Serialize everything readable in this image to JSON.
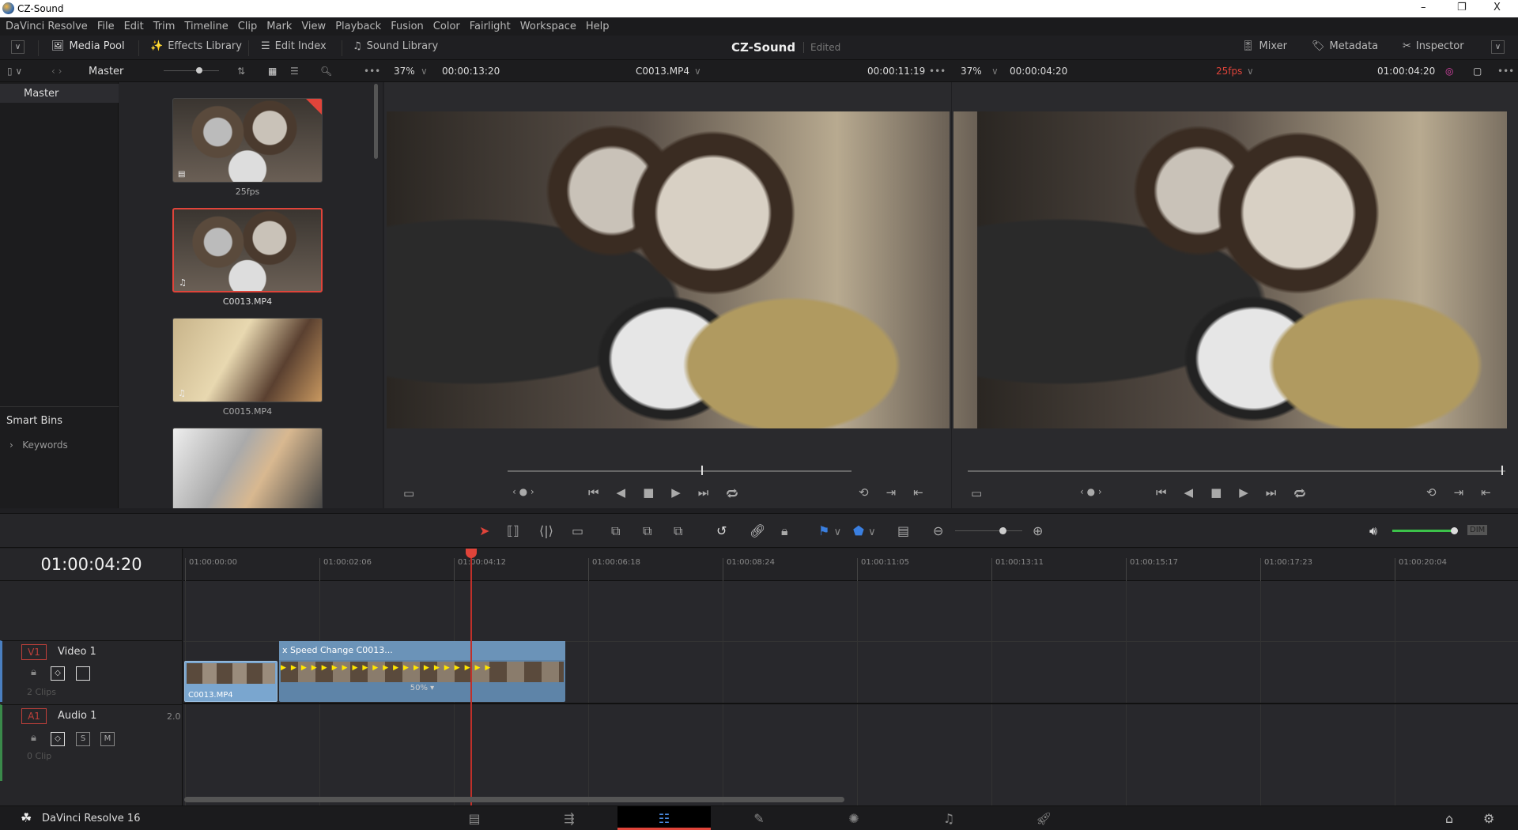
{
  "window": {
    "title": "CZ-Sound",
    "minimize": "–",
    "restore": "❐",
    "close": "X"
  },
  "menu": [
    "DaVinci Resolve",
    "File",
    "Edit",
    "Trim",
    "Timeline",
    "Clip",
    "Mark",
    "View",
    "Playback",
    "Fusion",
    "Color",
    "Fairlight",
    "Workspace",
    "Help"
  ],
  "toolbar": {
    "media_pool": "Media Pool",
    "effects_library": "Effects Library",
    "edit_index": "Edit Index",
    "sound_library": "Sound Library",
    "project_title": "CZ-Sound",
    "project_status": "Edited",
    "mixer": "Mixer",
    "metadata": "Metadata",
    "inspector": "Inspector"
  },
  "pool_header": {
    "bin": "Master"
  },
  "source_viewer": {
    "zoom": "37%",
    "duration": "00:00:13:20",
    "clip": "C0013.MP4",
    "timecode": "00:00:11:19"
  },
  "timeline_viewer": {
    "zoom": "37%",
    "duration": "00:00:04:20",
    "fps": "25fps",
    "timecode": "01:00:04:20"
  },
  "bins": {
    "master": "Master",
    "smart_bins": "Smart Bins",
    "keywords": "Keywords"
  },
  "media_pool": {
    "clips": [
      {
        "label": "25fps"
      },
      {
        "label": "C0013.MP4"
      },
      {
        "label": "C0015.MP4"
      },
      {
        "label": ""
      }
    ]
  },
  "timeline": {
    "timecode": "01:00:04:20",
    "ruler": [
      "01:00:00:00",
      "01:00:02:06",
      "01:00:04:12",
      "01:00:06:18",
      "01:00:08:24",
      "01:00:11:05",
      "01:00:13:11",
      "01:00:15:17",
      "01:00:17:23",
      "01:00:20:04"
    ],
    "video_track": {
      "id": "V1",
      "name": "Video 1",
      "clips_count": "2 Clips"
    },
    "audio_track": {
      "id": "A1",
      "name": "Audio 1",
      "channels": "2.0",
      "clips_count": "0 Clip",
      "solo": "S",
      "mute": "M"
    },
    "clip1": "C0013.MP4",
    "clip2_title": "Speed Change  C0013...",
    "clip2_close": "x",
    "clip2_speed": "50% ▾",
    "dim": "DIM"
  },
  "footer": {
    "app": "DaVinci Resolve 16"
  },
  "colors": {
    "accent_red": "#e0443a",
    "clip_blue": "#6b93b8",
    "volume_green": "#3cc24a"
  }
}
